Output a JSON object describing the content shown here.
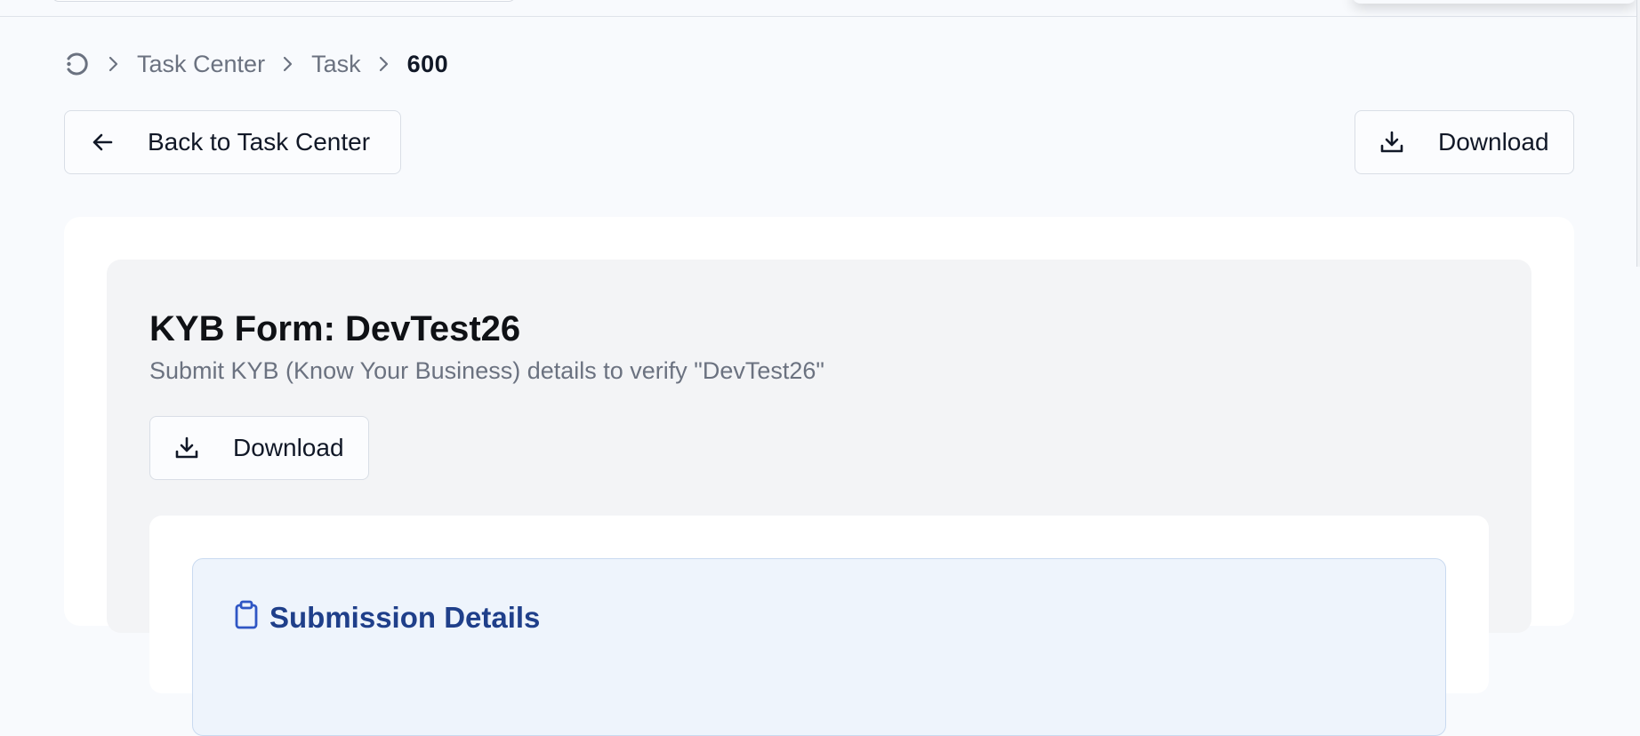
{
  "breadcrumb": {
    "home_icon": "refresh-icon",
    "items": [
      "Task Center",
      "Task"
    ],
    "current": "600"
  },
  "toolbar": {
    "back_label": "Back to Task Center",
    "back_icon": "arrow-left-icon",
    "download_label": "Download",
    "download_icon": "download-icon"
  },
  "form": {
    "title": "KYB Form: DevTest26",
    "subtitle": "Submit KYB (Know Your Business) details to verify \"DevTest26\"",
    "download_label": "Download",
    "download_icon": "download-icon"
  },
  "submission": {
    "heading": "Submission Details",
    "icon": "clipboard-icon"
  },
  "colors": {
    "page_bg": "#f8fafd",
    "card_bg": "#ffffff",
    "inner_card_bg": "#f3f4f6",
    "details_panel_bg": "#eef4fc",
    "accent_blue": "#1f3f8a",
    "muted_text": "#6b7280"
  }
}
